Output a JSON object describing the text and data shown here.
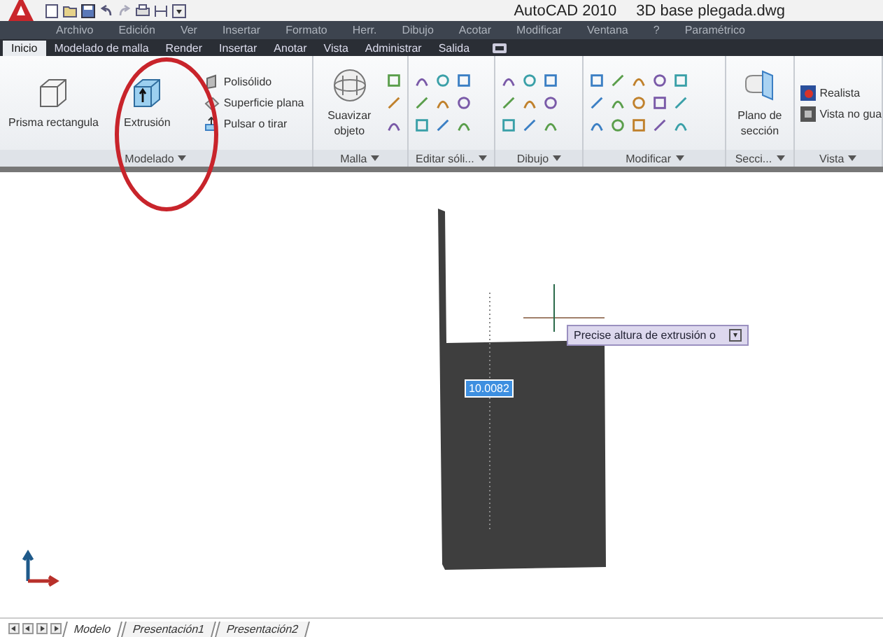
{
  "window": {
    "app": "AutoCAD 2010",
    "file": "3D base plegada.dwg"
  },
  "menu": [
    "Archivo",
    "Edición",
    "Ver",
    "Insertar",
    "Formato",
    "Herr.",
    "Dibujo",
    "Acotar",
    "Modificar",
    "Ventana",
    "?",
    "Paramétrico"
  ],
  "ribbon_tabs": [
    {
      "label": "Inicio",
      "selected": true
    },
    {
      "label": "Modelado de malla",
      "selected": false
    },
    {
      "label": "Render",
      "selected": false
    },
    {
      "label": "Insertar",
      "selected": false
    },
    {
      "label": "Anotar",
      "selected": false
    },
    {
      "label": "Vista",
      "selected": false
    },
    {
      "label": "Administrar",
      "selected": false
    },
    {
      "label": "Salida",
      "selected": false
    }
  ],
  "panels": [
    {
      "title": "Modelado",
      "tools": [
        {
          "kind": "large",
          "label": "Prisma rectangula"
        },
        {
          "kind": "large",
          "label": "Extrusión",
          "highlighted": true
        },
        {
          "kind": "small",
          "label": "Polisólido"
        },
        {
          "kind": "small",
          "label": "Superficie plana"
        },
        {
          "kind": "small",
          "label": "Pulsar o tirar"
        }
      ]
    },
    {
      "title": "Malla",
      "tools": [
        {
          "kind": "large",
          "label": "Suavizar objeto"
        },
        {
          "kind": "icons"
        }
      ]
    },
    {
      "title": "Editar sóli...",
      "tools": [
        {
          "kind": "icons"
        }
      ]
    },
    {
      "title": "Dibujo",
      "tools": [
        {
          "kind": "icons"
        }
      ]
    },
    {
      "title": "Modificar",
      "tools": [
        {
          "kind": "icons"
        }
      ]
    },
    {
      "title": "Secci...",
      "tools": [
        {
          "kind": "large",
          "label": "Plano de sección"
        }
      ]
    },
    {
      "title": "Vista",
      "tools": [
        {
          "kind": "small",
          "label": "Realista"
        },
        {
          "kind": "small",
          "label": "Vista no gua"
        }
      ]
    }
  ],
  "viewport": {
    "prompt": "Precise altura de extrusión o",
    "input": "10.0082"
  },
  "layout_tabs": [
    {
      "label": "Modelo",
      "selected": true
    },
    {
      "label": "Presentación1",
      "selected": false
    },
    {
      "label": "Presentación2",
      "selected": false
    }
  ]
}
